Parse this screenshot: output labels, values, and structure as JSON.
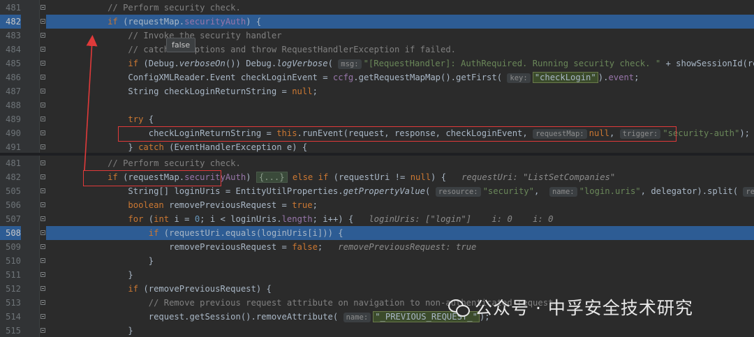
{
  "top_pane": {
    "lines": [
      {
        "n": "481",
        "tokens": [
          [
            "ind",
            "            "
          ],
          [
            "cm",
            "// Perform security check."
          ]
        ]
      },
      {
        "n": "482",
        "hl": true,
        "tokens": [
          [
            "ind",
            "            "
          ],
          [
            "kw",
            "if "
          ],
          [
            "",
            "("
          ],
          [
            "",
            "requestMap"
          ],
          [
            "",
            "."
          ],
          [
            "fld",
            "securityAuth"
          ],
          [
            "",
            ") {"
          ]
        ]
      },
      {
        "n": "483",
        "tokens": [
          [
            "ind",
            "                "
          ],
          [
            "cm",
            "// Invoke the security handler"
          ]
        ]
      },
      {
        "n": "484",
        "tokens": [
          [
            "ind",
            "                "
          ],
          [
            "cm",
            "// catch exceptions and throw RequestHandlerException if failed."
          ]
        ]
      },
      {
        "n": "485",
        "tokens": [
          [
            "ind",
            "                "
          ],
          [
            "kw",
            "if "
          ],
          [
            "",
            "(Debug."
          ],
          [
            "it",
            "verboseOn"
          ],
          [
            "",
            "()) Debug."
          ],
          [
            "it",
            "logVerbose"
          ],
          [
            "",
            "( "
          ],
          [
            "hint",
            "msg:"
          ],
          [
            "str",
            "\"[RequestHandler]: AuthRequired. Running security check. \""
          ],
          [
            "",
            " + showSessionId(request), "
          ],
          [
            "fld it",
            "module"
          ],
          [
            "",
            ");"
          ]
        ]
      },
      {
        "n": "486",
        "tokens": [
          [
            "ind",
            "                "
          ],
          [
            "",
            "ConfigXMLReader.Event checkLoginEvent = "
          ],
          [
            "fld",
            "ccfg"
          ],
          [
            "",
            ".getRequestMapMap().getFirst( "
          ],
          [
            "hint",
            "key:"
          ],
          [
            "strhl",
            "\"checkLogin\""
          ],
          [
            "",
            ")."
          ],
          [
            "fld",
            "event"
          ],
          [
            "",
            ";"
          ]
        ]
      },
      {
        "n": "487",
        "tokens": [
          [
            "ind",
            "                "
          ],
          [
            "",
            "String checkLoginReturnString = "
          ],
          [
            "kw",
            "null"
          ],
          [
            "",
            ";"
          ]
        ]
      },
      {
        "n": "488",
        "tokens": [
          [
            "",
            ""
          ]
        ]
      },
      {
        "n": "489",
        "tokens": [
          [
            "ind",
            "                "
          ],
          [
            "kw",
            "try "
          ],
          [
            "",
            "{"
          ]
        ]
      },
      {
        "n": "490",
        "tokens": [
          [
            "ind",
            "                    "
          ],
          [
            "",
            "checkLoginReturnString = "
          ],
          [
            "kw",
            "this"
          ],
          [
            "",
            ".runEvent(request, response, checkLoginEvent, "
          ],
          [
            "hint",
            "requestMap:"
          ],
          [
            "kw",
            "null"
          ],
          [
            "",
            ", "
          ],
          [
            "hint",
            "trigger:"
          ],
          [
            "str",
            "\"security-auth\""
          ],
          [
            "",
            ");"
          ]
        ]
      },
      {
        "n": "491",
        "tokens": [
          [
            "ind",
            "                "
          ],
          [
            "",
            "} "
          ],
          [
            "kw",
            "catch "
          ],
          [
            "",
            "(EventHandlerException e) {"
          ]
        ]
      }
    ]
  },
  "bottom_pane": {
    "lines": [
      {
        "n": "481",
        "tokens": [
          [
            "ind",
            "            "
          ],
          [
            "cm",
            "// Perform security check."
          ]
        ]
      },
      {
        "n": "482",
        "tokens": [
          [
            "ind",
            "            "
          ],
          [
            "kw",
            "if "
          ],
          [
            "",
            "(requestMap."
          ],
          [
            "fld",
            "securityAuth"
          ],
          [
            "",
            ") "
          ],
          [
            "fold-ph",
            "{...}"
          ],
          [
            "",
            " "
          ],
          [
            "kw",
            "else if "
          ],
          [
            "",
            "(requestUri != "
          ],
          [
            "kw",
            "null"
          ],
          [
            "",
            ") {   "
          ],
          [
            "inl",
            "requestUri: \"ListSetCompanies\""
          ]
        ]
      },
      {
        "n": "505",
        "tokens": [
          [
            "ind",
            "                "
          ],
          [
            "",
            "String[] loginUris = EntityUtilProperties."
          ],
          [
            "it",
            "getPropertyValue"
          ],
          [
            "",
            "( "
          ],
          [
            "hint",
            "resource:"
          ],
          [
            "str",
            "\"security\""
          ],
          [
            "",
            ",  "
          ],
          [
            "hint",
            "name:"
          ],
          [
            "str",
            "\"login.uris\""
          ],
          [
            "",
            ", delegator).split( "
          ],
          [
            "hint",
            "regex:"
          ],
          [
            "str",
            "\",\""
          ],
          [
            "",
            ");"
          ]
        ]
      },
      {
        "n": "506",
        "tokens": [
          [
            "ind",
            "                "
          ],
          [
            "kw",
            "boolean "
          ],
          [
            "",
            "removePreviousRequest = "
          ],
          [
            "kw",
            "true"
          ],
          [
            "",
            ";"
          ]
        ]
      },
      {
        "n": "507",
        "tokens": [
          [
            "ind",
            "                "
          ],
          [
            "kw",
            "for "
          ],
          [
            "",
            "("
          ],
          [
            "kw",
            "int "
          ],
          [
            "",
            "i = "
          ],
          [
            "num",
            "0"
          ],
          [
            "",
            "; i < loginUris."
          ],
          [
            "fld",
            "length"
          ],
          [
            "",
            "; i++) {   "
          ],
          [
            "inl",
            "loginUris: [\"login\"]    i: 0    i: 0"
          ]
        ]
      },
      {
        "n": "508",
        "hl": true,
        "tokens": [
          [
            "ind",
            "                    "
          ],
          [
            "kw",
            "if "
          ],
          [
            "",
            "(requestUri.equals(loginUris[i])) {"
          ]
        ]
      },
      {
        "n": "509",
        "tokens": [
          [
            "ind",
            "                        "
          ],
          [
            "",
            "removePreviousRequest = "
          ],
          [
            "kw",
            "false"
          ],
          [
            "",
            ";   "
          ],
          [
            "inl",
            "removePreviousRequest: true"
          ]
        ]
      },
      {
        "n": "510",
        "tokens": [
          [
            "ind",
            "                    "
          ],
          [
            "",
            "}"
          ]
        ]
      },
      {
        "n": "511",
        "tokens": [
          [
            "ind",
            "                "
          ],
          [
            "",
            "}"
          ]
        ]
      },
      {
        "n": "512",
        "tokens": [
          [
            "ind",
            "                "
          ],
          [
            "kw",
            "if "
          ],
          [
            "",
            "(removePreviousRequest) {"
          ]
        ]
      },
      {
        "n": "513",
        "tokens": [
          [
            "ind",
            "                    "
          ],
          [
            "cm",
            "// Remove previous request attribute on navigation to non-authenticated request"
          ]
        ]
      },
      {
        "n": "514",
        "tokens": [
          [
            "ind",
            "                    "
          ],
          [
            "",
            "request.getSession().removeAttribute( "
          ],
          [
            "hint",
            "name:"
          ],
          [
            "strhl",
            "\"_PREVIOUS_REQUEST_\""
          ],
          [
            "",
            ");"
          ]
        ]
      },
      {
        "n": "515",
        "tokens": [
          [
            "ind",
            "                "
          ],
          [
            "",
            "}"
          ]
        ]
      }
    ]
  },
  "tooltip": {
    "text": "false"
  },
  "watermark": {
    "text": "公众号 · 中孚安全技术研究"
  },
  "colors": {
    "highlight": "#2d5c94",
    "annotation": "#e03a3a",
    "keyword": "#cc7832",
    "string": "#6a8759",
    "comment": "#808080",
    "field": "#9876aa"
  }
}
